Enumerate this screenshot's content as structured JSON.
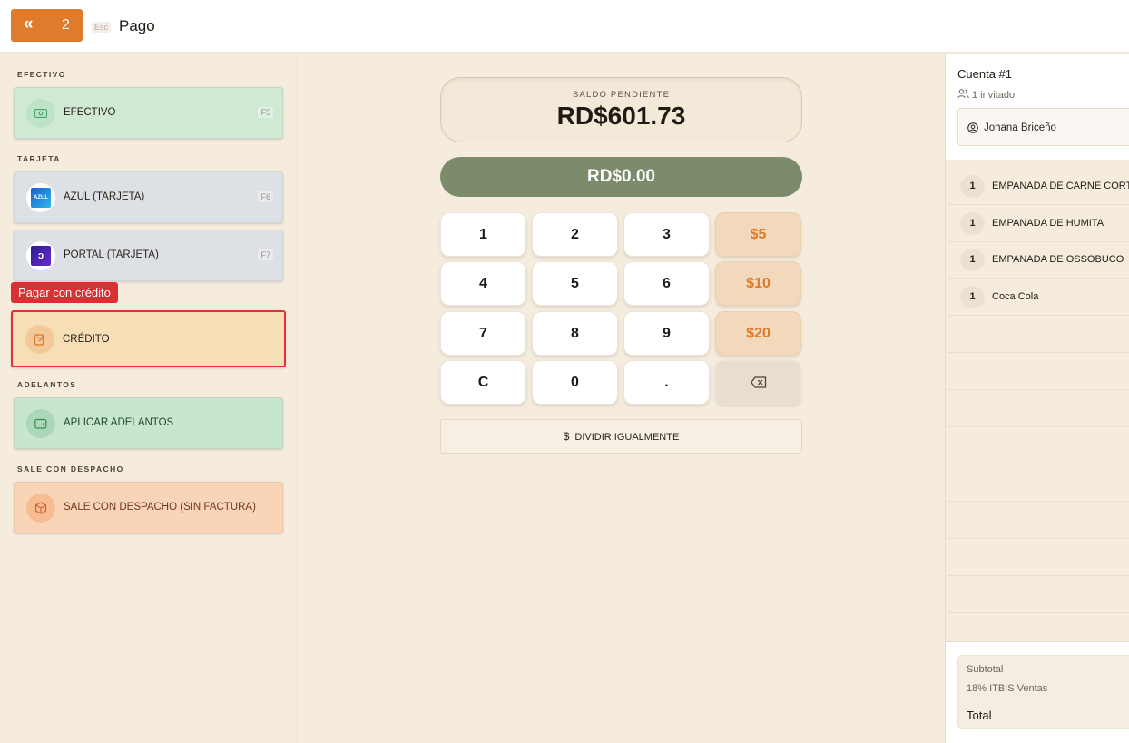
{
  "header": {
    "back_icon": "«",
    "back_count": "2",
    "esc_hint": "Esc",
    "title": "Pago"
  },
  "sections": {
    "efectivo": "EFECTIVO",
    "tarjeta": "TARJETA",
    "adelantos": "ADELANTOS",
    "despacho": "SALE CON DESPACHO"
  },
  "methods": {
    "efectivo": {
      "label": "EFECTIVO",
      "key": "F5",
      "icon": "cash-icon"
    },
    "azul": {
      "label": "AZUL (TARJETA)",
      "key": "F6",
      "icon": "azul-logo",
      "logo_text": "AZUL"
    },
    "portal": {
      "label": "PORTAL (TARJETA)",
      "key": "F7",
      "icon": "portal-logo",
      "logo_text": "ↄ"
    },
    "credito": {
      "label": "CRÉDITO",
      "icon": "credit-note-icon"
    },
    "adelantos": {
      "label": "APLICAR ADELANTOS",
      "icon": "wallet-icon"
    },
    "despacho": {
      "label": "SALE CON DESPACHO (SIN FACTURA)",
      "icon": "package-icon"
    }
  },
  "tooltip": "Pagar con crédito",
  "balance": {
    "caption": "SALDO PENDIENTE",
    "amount": "RD$601.73",
    "entered": "RD$0.00"
  },
  "keypad": {
    "k1": "1",
    "k2": "2",
    "k3": "3",
    "q5": "$5",
    "k4": "4",
    "k5": "5",
    "k6": "6",
    "q10": "$10",
    "k7": "7",
    "k8": "8",
    "k9": "9",
    "q20": "$20",
    "clear": "C",
    "k0": "0",
    "dot": ".",
    "backspace_icon": "backspace-icon"
  },
  "divide": {
    "icon": "$",
    "label": "DIVIDIR IGUALMENTE"
  },
  "account": {
    "title": "Cuenta #1",
    "guests": "1 invitado",
    "guest_name": "Johana Briceño",
    "items": [
      {
        "qty": "1",
        "name": "EMPANADA DE CARNE CORTADA"
      },
      {
        "qty": "1",
        "name": "EMPANADA DE HUMITA"
      },
      {
        "qty": "1",
        "name": "EMPANADA DE OSSOBUCO"
      },
      {
        "qty": "1",
        "name": "Coca Cola"
      }
    ],
    "subtotal_label": "Subtotal",
    "itbis_label": "18% ITBIS Ventas",
    "total_label": "Total"
  },
  "colors": {
    "accent": "#e07b2c",
    "danger": "#dc2f34",
    "paid_pill": "#7b8b6c"
  }
}
